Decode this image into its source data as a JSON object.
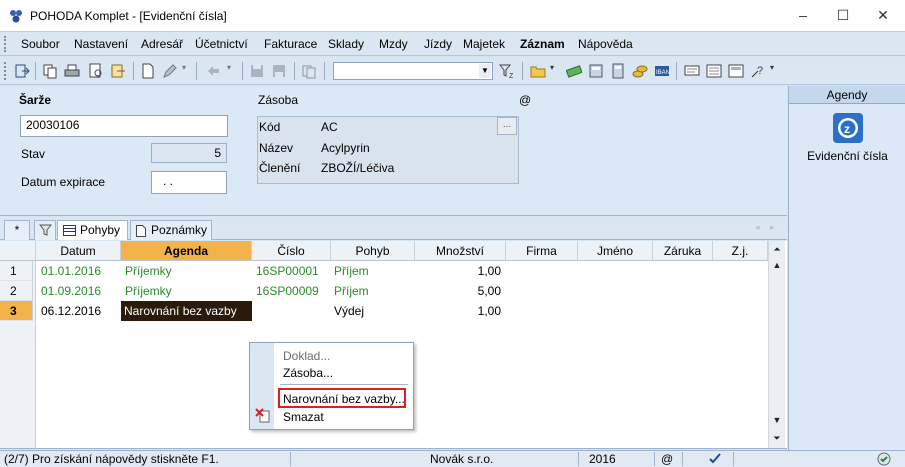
{
  "window": {
    "title": "POHODA Komplet - [Evidenční čísla]",
    "minimize": "–",
    "maximize": "☐",
    "close": "✕"
  },
  "menu": [
    {
      "label": "Soubor"
    },
    {
      "label": "Nastavení"
    },
    {
      "label": "Adresář"
    },
    {
      "label": "Účetnictví"
    },
    {
      "label": "Fakturace"
    },
    {
      "label": "Sklady"
    },
    {
      "label": "Mzdy"
    },
    {
      "label": "Jízdy"
    },
    {
      "label": "Majetek"
    },
    {
      "label": "Záznam"
    },
    {
      "label": "Nápověda"
    }
  ],
  "form": {
    "batch_label": "Šarže",
    "batch_value": "20030106",
    "status_label": "Stav",
    "status_value": "5",
    "expiry_label": "Datum expirace",
    "expiry_value": ". .",
    "stock_label": "Zásoba",
    "at_sign": "@",
    "code_label": "Kód",
    "code_value": "AC",
    "ellipsis": "...",
    "name_label": "Název",
    "name_value": "Acylpyrin",
    "category_label": "Členění",
    "category_value": "ZBOŽÍ/Léčiva"
  },
  "agendas": {
    "header": "Agendy",
    "item_label": "Evidenční čísla"
  },
  "tabs": {
    "star": "*",
    "movements": "Pohyby",
    "notes": "Poznámky"
  },
  "grid": {
    "columns": [
      "Datum",
      "Agenda",
      "Číslo",
      "Pohyb",
      "Množství",
      "Firma",
      "Jméno",
      "Záruka",
      "Z.j."
    ],
    "rows": [
      {
        "num": "1",
        "date": "01.01.2016",
        "agenda": "Příjemky",
        "number": "16SP00001",
        "movement": "Příjem",
        "qty": "1,00"
      },
      {
        "num": "2",
        "date": "01.09.2016",
        "agenda": "Příjemky",
        "number": "16SP00009",
        "movement": "Příjem",
        "qty": "5,00"
      },
      {
        "num": "3",
        "date": "06.12.2016",
        "agenda": "Narovnání bez vazby",
        "number": "",
        "movement": "Výdej",
        "qty": "1,00"
      }
    ]
  },
  "context_menu": {
    "document": "Doklad...",
    "stock": "Zásoba...",
    "adjustment": "Narovnání bez vazby...",
    "delete": "Smazat"
  },
  "status": {
    "hint": "(2/7) Pro získání nápovědy stiskněte F1.",
    "company": "Novák s.r.o.",
    "year": "2016",
    "at": "@"
  },
  "colors": {
    "accent": "#f3b24a",
    "green_text": "#2b8a2b",
    "highlight_border": "#e02020"
  }
}
